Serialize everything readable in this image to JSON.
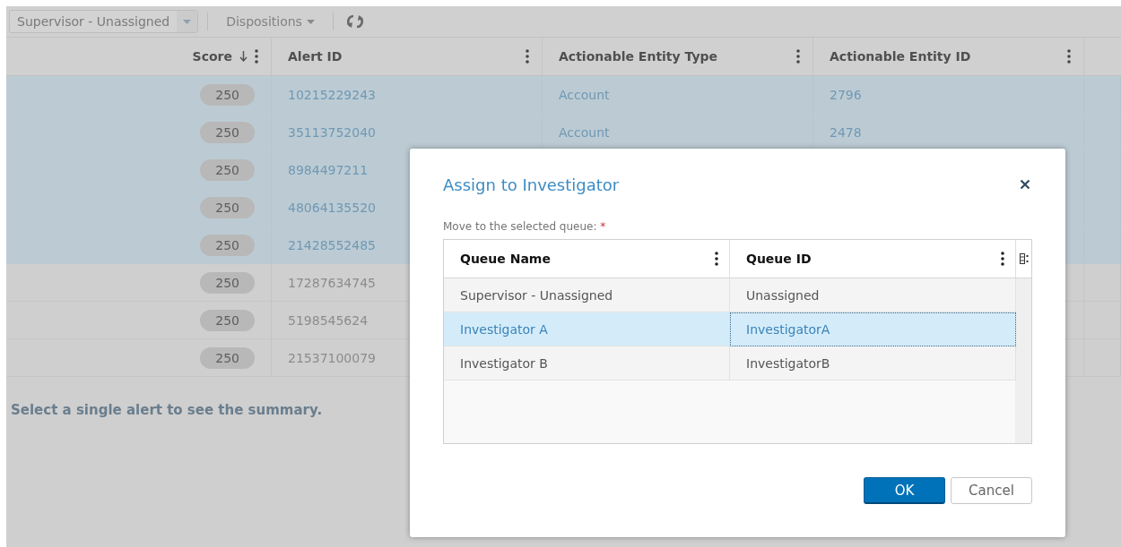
{
  "toolbar": {
    "queue_select": {
      "value": "Supervisor - Unassigned"
    },
    "dispositions": {
      "label": "Dispositions"
    }
  },
  "alerts_table": {
    "columns": [
      {
        "label": "Score",
        "sorted": true
      },
      {
        "label": "Alert ID",
        "sorted": false
      },
      {
        "label": "Actionable Entity Type",
        "sorted": false
      },
      {
        "label": "Actionable Entity ID",
        "sorted": false
      }
    ],
    "rows": [
      {
        "score": "250",
        "alert_id": "10215229243",
        "entity_type": "Account",
        "entity_id": "2796",
        "selected": true
      },
      {
        "score": "250",
        "alert_id": "35113752040",
        "entity_type": "Account",
        "entity_id": "2478",
        "selected": true
      },
      {
        "score": "250",
        "alert_id": "8984497211",
        "selected": true
      },
      {
        "score": "250",
        "alert_id": "48064135520",
        "selected": true
      },
      {
        "score": "250",
        "alert_id": "21428552485",
        "selected": true
      },
      {
        "score": "250",
        "alert_id": "17287634745",
        "selected": false
      },
      {
        "score": "250",
        "alert_id": "5198545624",
        "selected": false
      },
      {
        "score": "250",
        "alert_id": "21537100079",
        "selected": false
      }
    ]
  },
  "summary_message": "Select a single alert to see the summary.",
  "dialog": {
    "title": "Assign to Investigator",
    "field_label": "Move to the selected queue:",
    "required_mark": "*",
    "queue_table": {
      "columns": [
        "Queue Name",
        "Queue ID"
      ],
      "rows": [
        {
          "name": "Supervisor - Unassigned",
          "id": "Unassigned",
          "selected": false
        },
        {
          "name": "Investigator A",
          "id": "InvestigatorA",
          "selected": true
        },
        {
          "name": "Investigator B",
          "id": "InvestigatorB",
          "selected": false
        }
      ]
    },
    "buttons": [
      {
        "label": "OK",
        "kind": "primary"
      },
      {
        "label": "Cancel",
        "kind": "secondary"
      }
    ]
  }
}
